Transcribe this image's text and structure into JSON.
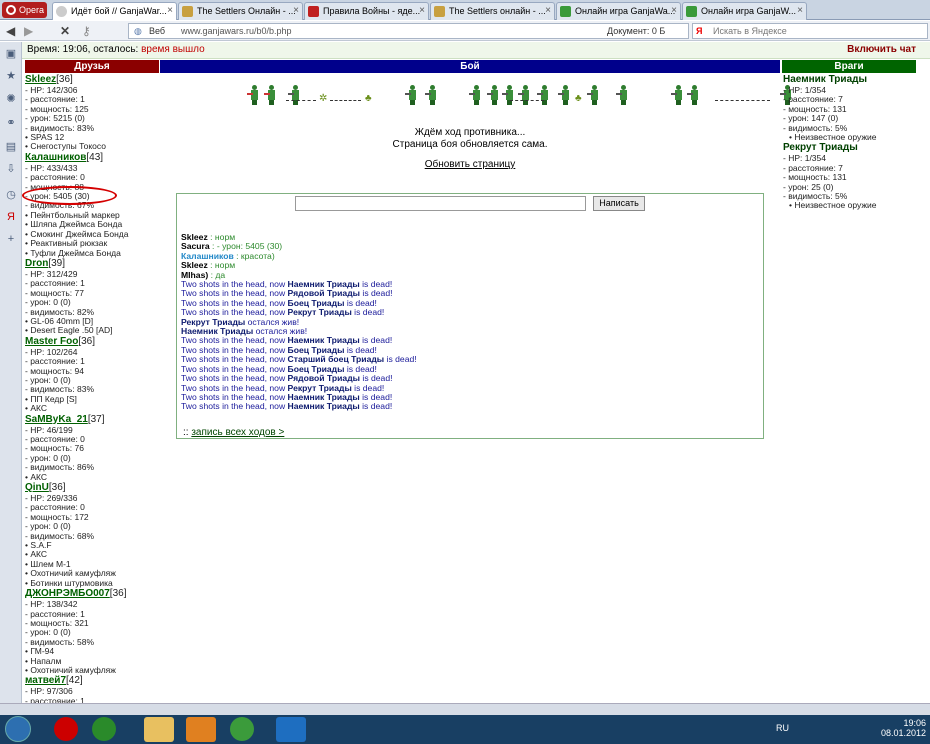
{
  "browser": {
    "opera_label": "Opera",
    "tabs": [
      {
        "label": "Идёт бой // GanjaWar..."
      },
      {
        "label": "The Settlers Онлайн - ..."
      },
      {
        "label": "Правила Войны - яде..."
      },
      {
        "label": "The Settlers онлайн - ..."
      },
      {
        "label": "Онлайн игра GanjaWa..."
      },
      {
        "label": "Онлайн игра GanjaW..."
      }
    ],
    "web_label": "Веб",
    "url": "www.ganjawars.ru/b0/b.php",
    "document_size": "Документ:   0 Б",
    "search_placeholder": "Искать в Яндексе",
    "search_engine_letter": "Я"
  },
  "status": {
    "time_text": "Время: 19:06, осталось: ",
    "remaining": "время вышло",
    "chat_toggle": "Включить чат"
  },
  "headers": {
    "friends": "Друзья",
    "battle": "Бой",
    "enemies": "Враги"
  },
  "colors": {
    "friends_header": "#8b0000",
    "battle_header": "#00008b",
    "enemies_header": "#006400"
  },
  "friends": [
    {
      "name": "Skleez",
      "level": "[36]",
      "stats": [
        "- HP: 142/306",
        "- расстояние: 1",
        "- мощность: 125",
        "- урон: 5215 (0)",
        "- видимость: 83%"
      ],
      "items": [
        "• SPAS 12",
        "• Снегоступы Токосо"
      ]
    },
    {
      "name": "Калашников",
      "level": "[43]",
      "stats": [
        "- HP: 433/433",
        "- расстояние: 0",
        "- мощность: 88",
        "- урон: 5405 (30)",
        "- видимость: 67%"
      ],
      "items": [
        "• Пейнтбольный маркер",
        "• Шляпа Джеймса Бонда",
        "• Смокинг Джеймса Бонда",
        "• Реактивный рюкзак",
        "• Туфли Джеймса Бонда"
      ]
    },
    {
      "name": "Dron",
      "level": "[39]",
      "stats": [
        "- HP: 312/429",
        "- расстояние: 1",
        "- мощность: 77",
        "- урон: 0 (0)",
        "- видимость: 82%"
      ],
      "items": [
        "• GL-06 40mm [D]",
        "• Desert Eagle .50 [AD]"
      ]
    },
    {
      "name": "Master Foo",
      "level": "[36]",
      "stats": [
        "- HP: 102/264",
        "- расстояние: 1",
        "- мощность: 94",
        "- урон: 0 (0)",
        "- видимость: 83%"
      ],
      "items": [
        "• ПП Кедр [S]",
        "• АКС"
      ]
    },
    {
      "name": "SaMByKa_21",
      "level": "[37]",
      "stats": [
        "- HP: 46/199",
        "- расстояние: 0",
        "- мощность: 76",
        "- урон: 0 (0)",
        "- видимость: 86%"
      ],
      "items": [
        "• АКС"
      ]
    },
    {
      "name": "QinU",
      "level": "[36]",
      "stats": [
        "- HP: 269/336",
        "- расстояние: 0",
        "- мощность: 172",
        "- урон: 0 (0)",
        "- видимость: 68%"
      ],
      "items": [
        "• S.A.F",
        "• АКС",
        "• Шлем М-1",
        "• Охотничий камуфляж",
        "• Ботинки штурмовика"
      ]
    },
    {
      "name": "ДЖОНРЭМБО007",
      "level": "[36]",
      "stats": [
        "- HP: 138/342",
        "- расстояние: 1",
        "- мощность: 321",
        "- урон: 0 (0)",
        "- видимость: 58%"
      ],
      "items": [
        "• ГМ-94",
        "• Напалм",
        "• Охотничий камуфляж"
      ]
    },
    {
      "name": "матвей7",
      "level": "[42]",
      "stats": [
        "- HP: 97/306",
        "- расстояние: 1"
      ],
      "items": []
    }
  ],
  "enemies": [
    {
      "name": "Наемник Триады",
      "stats": [
        "- HP: 1/354",
        "- расстояние: 7",
        "- мощность: 131",
        "- урон: 147 (0)",
        "- видимость: 5%"
      ],
      "items": [
        "• Неизвестное оружие"
      ]
    },
    {
      "name": "Рекрут Триады",
      "stats": [
        "- HP: 1/354",
        "- расстояние: 7",
        "- мощность: 131",
        "- урон: 25 (0)",
        "- видимость: 5%"
      ],
      "items": [
        "• Неизвестное оружие"
      ]
    }
  ],
  "battle": {
    "waiting_line1": "Ждём ход противника...",
    "waiting_line2": "Страница боя обновляется сама.",
    "refresh_link": "Обновить страницу",
    "send_button": "Написать",
    "message_value": "",
    "history_prefix": ":: ",
    "history_link": "запись всех ходов >"
  },
  "chat": [
    {
      "name": "Skleez",
      "text": " : норм"
    },
    {
      "name": "Sacura",
      "text": " : - урон: 5405 (30)"
    },
    {
      "name": "Калашников",
      "text": " : красота)",
      "blue": true
    },
    {
      "name": "Skleez",
      "text": " : норм"
    },
    {
      "name": "MIhas)",
      "text": " : да"
    }
  ],
  "log": [
    {
      "pre": "Two shots in the head, now ",
      "b": "Наемник Триады",
      "post": " is dead!"
    },
    {
      "pre": "Two shots in the head, now ",
      "b": "Рядовой Триады",
      "post": " is dead!"
    },
    {
      "pre": "Two shots in the head, now ",
      "b": "Боец Триады",
      "post": " is dead!"
    },
    {
      "pre": "Two shots in the head, now ",
      "b": "Рекрут Триады",
      "post": " is dead!"
    },
    {
      "pre": "",
      "b": "Рекрут Триады",
      "post": " остался жив!"
    },
    {
      "pre": "",
      "b": "Наемник Триады",
      "post": " остался жив!"
    },
    {
      "pre": "Two shots in the head, now ",
      "b": "Наемник Триады",
      "post": " is dead!"
    },
    {
      "pre": "Two shots in the head, now ",
      "b": "Боец Триады",
      "post": " is dead!"
    },
    {
      "pre": "Two shots in the head, now ",
      "b": "Старший боец Триады",
      "post": " is dead!"
    },
    {
      "pre": "Two shots in the head, now ",
      "b": "Боец Триады",
      "post": " is dead!"
    },
    {
      "pre": "Two shots in the head, now ",
      "b": "Рядовой Триады",
      "post": " is dead!"
    },
    {
      "pre": "Two shots in the head, now ",
      "b": "Рекрут Триады",
      "post": " is dead!"
    },
    {
      "pre": "Two shots in the head, now ",
      "b": "Наемник Триады",
      "post": " is dead!"
    },
    {
      "pre": "Two shots in the head, now ",
      "b": "Наемник Триады",
      "post": " is dead!"
    }
  ],
  "taskbar": {
    "lang": "RU",
    "clock_time": "19:06",
    "clock_date": "08.01.2012"
  }
}
